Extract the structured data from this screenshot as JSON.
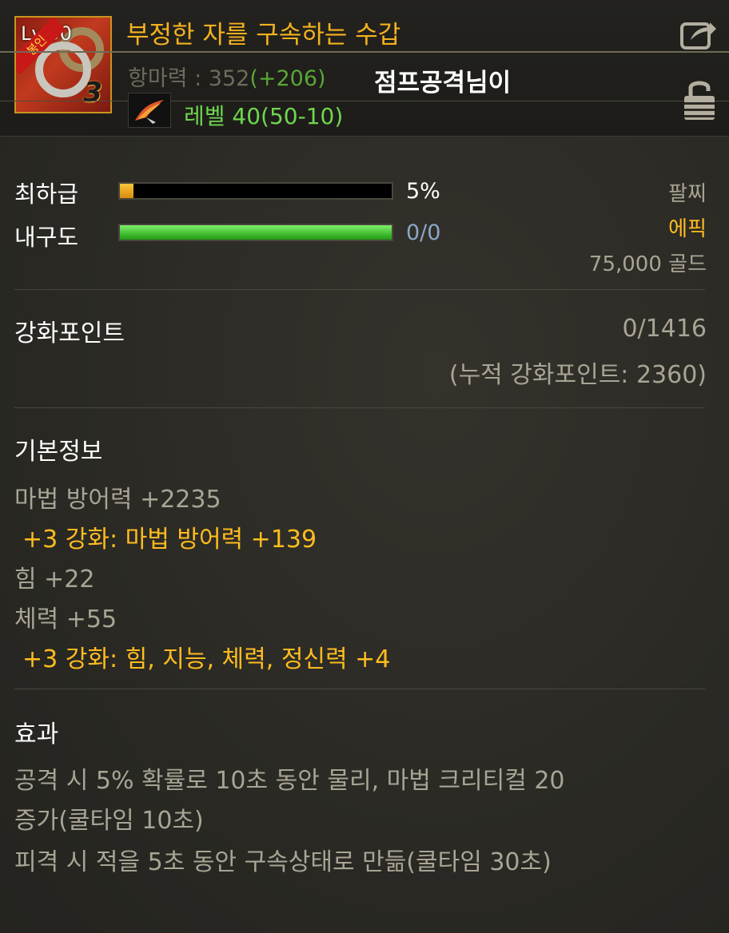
{
  "item": {
    "name": "부정한 자를 구속하는 수갑",
    "icon_level_text": "Lv.50",
    "icon_badge_text": "봉인",
    "icon_enhance_text": "3",
    "magic_resist_label": "항마력 : 352",
    "magic_resist_bonus": "(+206)",
    "owner": "점프공격님이",
    "level_req": "레벨 40(50-10)"
  },
  "grade": {
    "label": "최하급",
    "value_text": "5%",
    "value": 0.05
  },
  "durability": {
    "label": "내구도",
    "value_text": "0/0",
    "fill": 1.0
  },
  "item_meta": {
    "part": "팔찌",
    "rarity": "에픽",
    "price": "75,000 골드"
  },
  "enhance_points": {
    "label": "강화포인트",
    "value": "0/1416",
    "accumulated": "(누적 강화포인트: 2360)"
  },
  "basic_info": {
    "title": "기본정보",
    "lines": [
      "마법 방어력 +2235",
      "+3 강화: 마법 방어력 +139",
      "힘 +22",
      "체력 +55",
      "+3 강화: 힘, 지능, 체력, 정신력 +4"
    ]
  },
  "effects": {
    "title": "효과",
    "lines": [
      "공격 시 5% 확률로 10초 동안 물리, 마법 크리티컬 20",
      "증가(쿨타임 10초)",
      "피격 시 적을 5초 동안 구속상태로 만듦(쿨타임 30초)"
    ]
  },
  "colors": {
    "item_name": "#f4b21f",
    "epic": "#ffbc1f",
    "bonus_green": "#59a637",
    "level_green": "#6fd64e",
    "enhance_gold": "#ffbc1f",
    "durability_blue": "#8ba7c9"
  },
  "icons": {
    "share": "share-icon",
    "lock": "unlock-icon",
    "skill": "fire-quill-icon"
  }
}
